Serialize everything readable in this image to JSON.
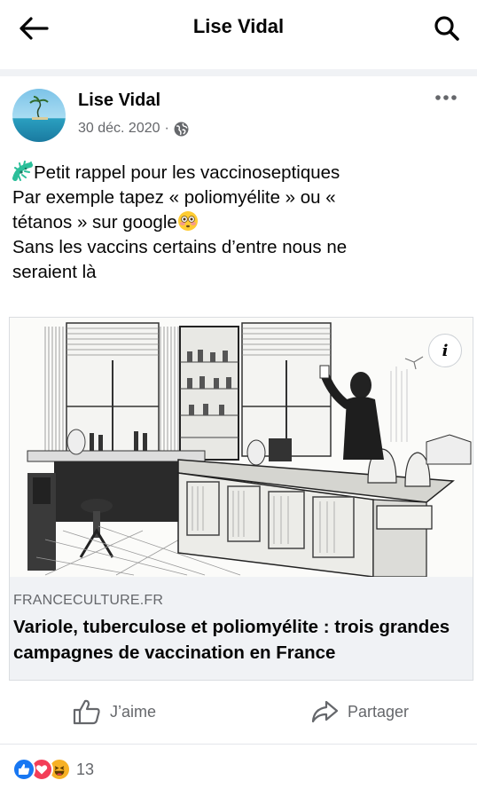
{
  "topbar": {
    "title": "Lise Vidal",
    "back_icon": "arrow-left-icon",
    "search_icon": "search-icon"
  },
  "post": {
    "author": "Lise Vidal",
    "date": "30 déc. 2020",
    "separator": "·",
    "privacy_icon": "globe-icon",
    "text_lines": [
      "Petit rappel pour les vaccinoseptiques",
      "Par exemple tapez « poliomyélite » ou «",
      "tétanos » sur google",
      "Sans les vaccins certains d’entre nous ne",
      "seraient là"
    ],
    "emojis": [
      "microbe-emoji",
      "flushed-face-emoji"
    ]
  },
  "link": {
    "domain": "FRANCECULTURE.FR",
    "title": "Variole, tuberculose et poliomyélite : trois grandes campagnes de vaccination en France",
    "info_label": "i"
  },
  "actions": {
    "like_label": "J’aime",
    "share_label": "Partager"
  },
  "reactions": {
    "count": "13",
    "types": [
      "like",
      "love",
      "haha"
    ]
  },
  "colors": {
    "text": "#050505",
    "secondary": "#65676b",
    "like_blue": "#1877f2",
    "love_red": "#f33e58",
    "haha_yellow": "#f7b125",
    "card_bg": "#f0f2f5"
  }
}
